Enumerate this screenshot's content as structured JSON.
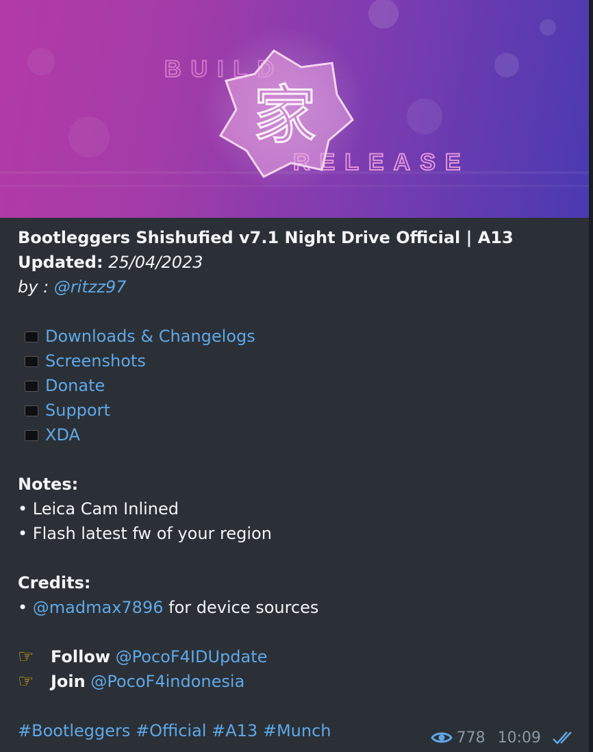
{
  "banner": {
    "word_top": "BUILD",
    "word_bottom": "RELEASE",
    "emblem_glyph": "家",
    "colors": {
      "pink": "#b33aa6",
      "purple": "#7f3cb0",
      "blue": "#4a3ab0"
    }
  },
  "post": {
    "title": "Bootleggers Shishufied v7.1 Night Drive Official | A13",
    "updated_label": "Updated:",
    "updated_value": "25/04/2023",
    "by_label": "by :",
    "by_handle": "@ritzz97",
    "links": [
      {
        "label": "Downloads & Changelogs",
        "icon": "black-square-icon"
      },
      {
        "label": "Screenshots",
        "icon": "black-square-icon"
      },
      {
        "label": "Donate",
        "icon": "black-square-icon"
      },
      {
        "label": "Support",
        "icon": "black-square-icon"
      },
      {
        "label": "XDA",
        "icon": "black-square-icon"
      }
    ],
    "notes_heading": "Notes:",
    "notes": [
      "• Leica Cam Inlined",
      "• Flash latest fw of your region"
    ],
    "credits_heading": "Credits:",
    "credit_bullet": "•",
    "credit_handle": "@madmax7896",
    "credit_text": "for device sources",
    "follow_label": "Follow",
    "follow_handle": "@PocoF4IDUpdate",
    "join_label": "Join",
    "join_handle": "@PocoF4indonesia",
    "hashtags": [
      "#Bootleggers",
      "#Official",
      "#A13",
      "#Munch"
    ]
  },
  "meta": {
    "views": "778",
    "time": "10:09",
    "icons": {
      "views": "eye-icon",
      "status": "double-check-icon"
    },
    "link_color": "#5fa8e8"
  }
}
